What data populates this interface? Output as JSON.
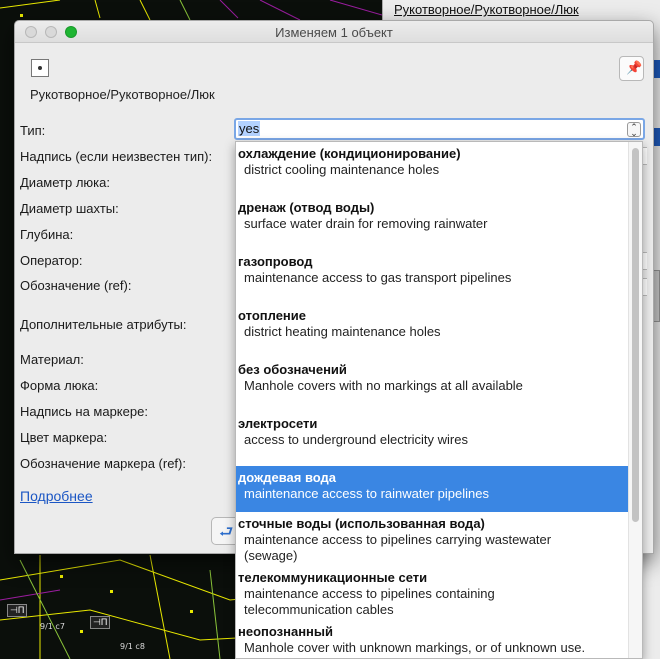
{
  "background": {
    "panel_title": "Рукотворное/Рукотворное/Люк",
    "map_labels": [
      "9/1 с7",
      "9/1 с8"
    ],
    "map_tags": [
      "⊣П",
      "⊣П"
    ]
  },
  "dialog": {
    "title": "Изменяем 1 объект",
    "preset_path": "Рукотворное/Рукотворное/Люк",
    "fields": [
      "Тип:",
      "Надпись (если неизвестен тип):",
      "Диаметр люка:",
      "Диаметр шахты:",
      "Глубина:",
      "Оператор:",
      "Обозначение (ref):",
      "Дополнительные атрибуты:",
      "Материал:",
      "Форма люка:",
      "Надпись на маркере:",
      "Цвет маркера:",
      "Обозначение маркера (ref):"
    ],
    "more_link": "Подробнее",
    "type_value": "yes",
    "dropdown": [
      {
        "title": "охлаждение (кондиционирование)",
        "desc": [
          "district cooling maintenance holes"
        ]
      },
      {
        "title": "дренаж (отвод воды)",
        "desc": [
          "surface water drain for removing rainwater"
        ]
      },
      {
        "title": "газопровод",
        "desc": [
          "maintenance access to gas transport pipelines"
        ]
      },
      {
        "title": "отопление",
        "desc": [
          "district heating maintenance holes"
        ]
      },
      {
        "title": "без обозначений",
        "desc": [
          "Manhole covers with no markings at all available"
        ]
      },
      {
        "title": "электросети",
        "desc": [
          "access to underground electricity wires"
        ]
      },
      {
        "title": "дождевая вода",
        "desc": [
          "maintenance access to rainwater pipelines"
        ],
        "selected": true
      },
      {
        "title": "сточные воды (использованная вода)",
        "desc": [
          "maintenance access to pipelines carrying wastewater",
          "(sewage)"
        ]
      },
      {
        "title": "телекоммуникационные сети",
        "desc": [
          "maintenance access to pipelines containing",
          "telecommunication cables"
        ]
      },
      {
        "title": "неопознанный",
        "desc": [
          "Manhole cover with unknown markings, or of unknown use."
        ]
      }
    ]
  },
  "icons": [
    "preset-manhole-icon",
    "pin-icon",
    "back-arrow-icon",
    "combo-arrows-icon"
  ],
  "colors": {
    "selection": "#3a86e3",
    "link": "#1b56c4",
    "focus": "#7aa7e6"
  }
}
